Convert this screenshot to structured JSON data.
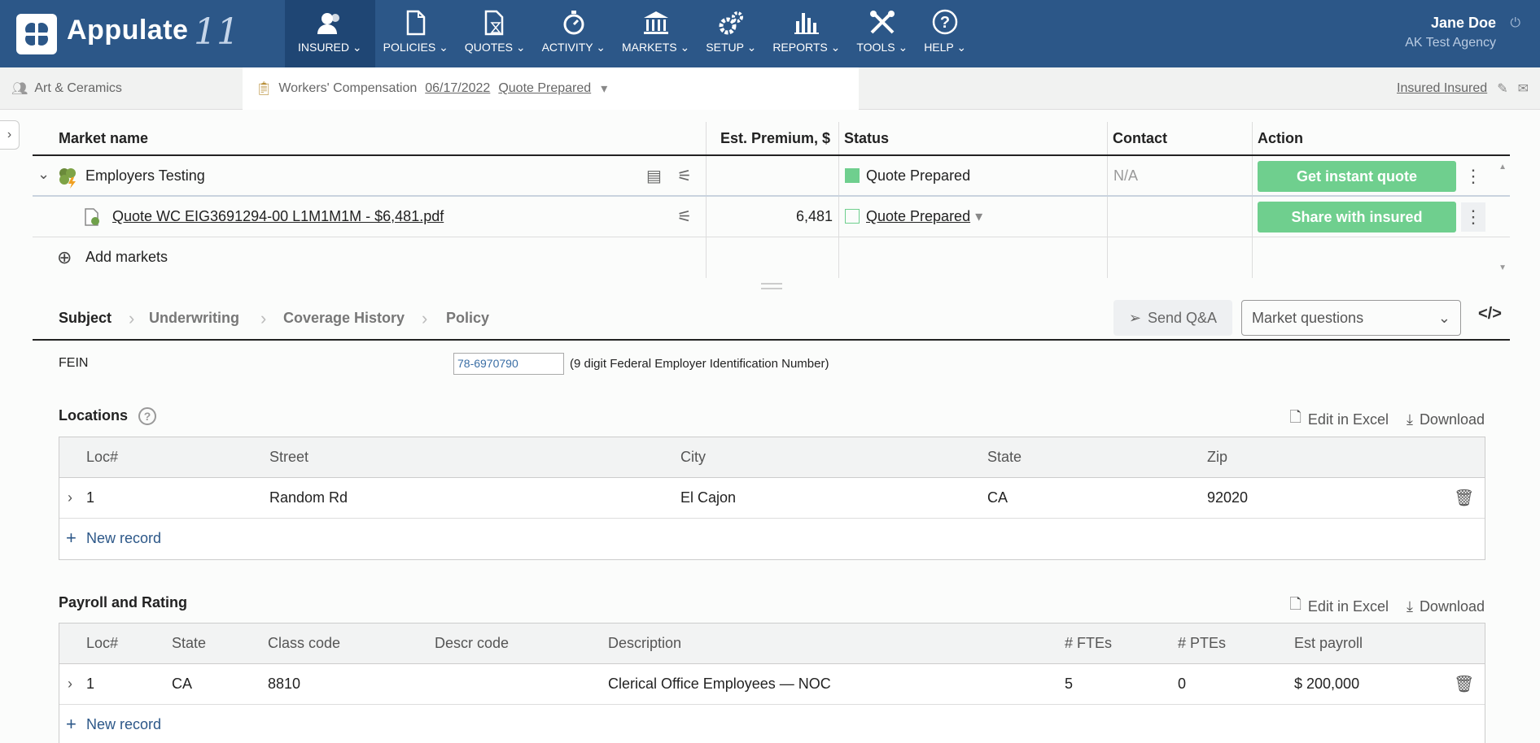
{
  "app": {
    "name": "Appulate",
    "version_mark": "11"
  },
  "nav": [
    {
      "label": "INSURED",
      "icon": "users-icon",
      "active": true
    },
    {
      "label": "POLICIES",
      "icon": "document-icon"
    },
    {
      "label": "QUOTES",
      "icon": "hourglass-document-icon"
    },
    {
      "label": "ACTIVITY",
      "icon": "stopwatch-icon"
    },
    {
      "label": "MARKETS",
      "icon": "bank-icon"
    },
    {
      "label": "SETUP",
      "icon": "gears-icon"
    },
    {
      "label": "REPORTS",
      "icon": "bar-chart-icon"
    },
    {
      "label": "TOOLS",
      "icon": "tools-icon"
    },
    {
      "label": "HELP",
      "icon": "help-icon"
    }
  ],
  "user": {
    "name": "Jane Doe",
    "agency": "AK Test Agency"
  },
  "subbar": {
    "insured_name": "Art & Ceramics",
    "policy_type": "Workers' Compensation",
    "policy_date": "06/17/2022",
    "policy_status": "Quote Prepared",
    "insured_link": "Insured Insured"
  },
  "markets_table": {
    "headers": {
      "name": "Market name",
      "premium": "Est. Premium, $",
      "status": "Status",
      "contact": "Contact",
      "action": "Action"
    },
    "market": {
      "name": "Employers Testing",
      "status": "Quote Prepared",
      "contact": "N/A",
      "action": "Get instant quote"
    },
    "quote": {
      "file": "Quote WC EIG3691294-00 L1M1M1M - $6,481.pdf",
      "premium": "6,481",
      "status": "Quote Prepared",
      "action": "Share with insured"
    },
    "add_markets": "Add markets"
  },
  "tabs": {
    "items": [
      "Subject",
      "Underwriting",
      "Coverage History",
      "Policy"
    ],
    "send_qa": "Send Q&A",
    "market_questions": "Market questions"
  },
  "fein": {
    "label": "FEIN",
    "value": "78-6970790",
    "hint": "(9 digit Federal Employer Identification Number)"
  },
  "locations": {
    "title": "Locations",
    "edit_excel": "Edit in Excel",
    "download": "Download",
    "headers": [
      "Loc#",
      "Street",
      "City",
      "State",
      "Zip"
    ],
    "rows": [
      {
        "loc": "1",
        "street": "Random Rd",
        "city": "El Cajon",
        "state": "CA",
        "zip": "92020"
      }
    ],
    "new_record": "New record"
  },
  "payroll": {
    "title": "Payroll and Rating",
    "edit_excel": "Edit in Excel",
    "download": "Download",
    "headers": [
      "Loc#",
      "State",
      "Class code",
      "Descr code",
      "Description",
      "# FTEs",
      "# PTEs",
      "Est payroll"
    ],
    "rows": [
      {
        "loc": "1",
        "state": "CA",
        "class_code": "8810",
        "descr_code": "",
        "description": "Clerical Office Employees — NOC",
        "ftes": "5",
        "ptes": "0",
        "payroll": "$ 200,000"
      }
    ],
    "new_record": "New record"
  },
  "colors": {
    "nav_bg": "#2c5788",
    "nav_active": "#1f4674",
    "green_button": "#6fcf8e",
    "status_green": "#6fcf8e"
  }
}
